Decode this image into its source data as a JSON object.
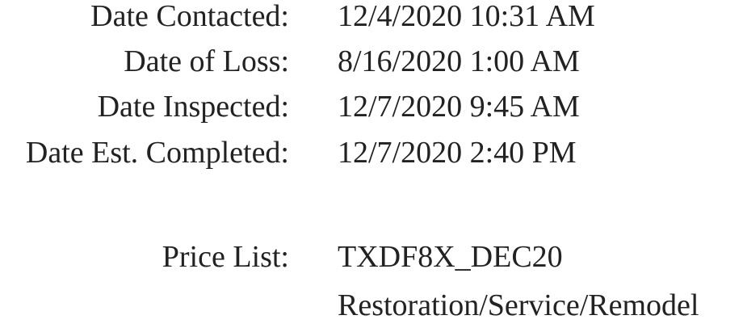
{
  "dates": [
    {
      "label": "Date Contacted:",
      "value": "12/4/2020 10:31 AM"
    },
    {
      "label": "Date of Loss:",
      "value": "8/16/2020 1:00 AM"
    },
    {
      "label": "Date Inspected:",
      "value": "12/7/2020 9:45 AM"
    },
    {
      "label": "Date Est. Completed:",
      "value": "12/7/2020 2:40 PM"
    }
  ],
  "price_list": {
    "label": "Price List:",
    "value": "TXDF8X_DEC20",
    "description": "Restoration/Service/Remodel"
  }
}
